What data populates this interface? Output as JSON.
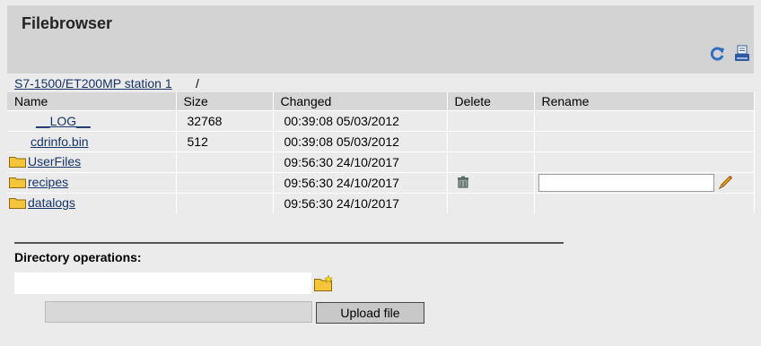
{
  "header": {
    "title": "Filebrowser"
  },
  "icons": {
    "refresh": "refresh-icon",
    "print": "print-icon",
    "folder": "folder-icon",
    "trash": "trash-icon",
    "pencil": "pencil-icon",
    "new_folder": "new-folder-icon"
  },
  "colors": {
    "header_bg": "#d3d3d3",
    "link": "#17336b",
    "page_bg": "#ebebeb",
    "folder": "#f4c43a"
  },
  "breadcrumb": {
    "path": "S7-1500/ET200MP station 1",
    "separator": "/"
  },
  "table": {
    "columns": [
      "Name",
      "Size",
      "Changed",
      "Delete",
      "Rename"
    ],
    "rows": [
      {
        "name": "__LOG__",
        "size": "32768",
        "changed": "00:39:08 05/03/2012"
      },
      {
        "name": "cdrinfo.bin",
        "size": "512",
        "changed": "00:39:08 05/03/2012"
      },
      {
        "name": "UserFiles",
        "size": "",
        "changed": "09:56:30 24/10/2017"
      },
      {
        "name": "recipes",
        "size": "",
        "changed": "09:56:30 24/10/2017"
      },
      {
        "name": "datalogs",
        "size": "",
        "changed": "09:56:30 24/10/2017"
      }
    ]
  },
  "directory_operations": {
    "title": "Directory operations:",
    "upload_label": "Upload file"
  }
}
